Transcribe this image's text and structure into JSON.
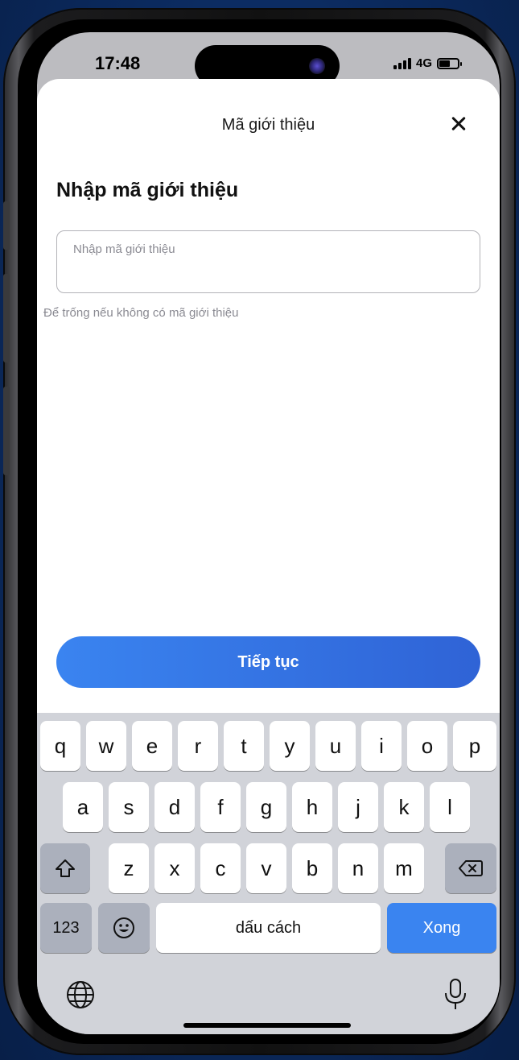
{
  "status_bar": {
    "time": "17:48",
    "network": "4G"
  },
  "sheet": {
    "title": "Mã giới thiệu",
    "heading": "Nhập mã giới thiệu",
    "input": {
      "placeholder": "Nhập mã giới thiệu",
      "value": ""
    },
    "hint": "Để trống nếu không có mã giới thiệu",
    "continue_label": "Tiếp tục"
  },
  "keyboard": {
    "row1": [
      "q",
      "w",
      "e",
      "r",
      "t",
      "y",
      "u",
      "i",
      "o",
      "p"
    ],
    "row2": [
      "a",
      "s",
      "d",
      "f",
      "g",
      "h",
      "j",
      "k",
      "l"
    ],
    "row3": [
      "z",
      "x",
      "c",
      "v",
      "b",
      "n",
      "m"
    ],
    "numbers_label": "123",
    "space_label": "dấu cách",
    "done_label": "Xong"
  },
  "colors": {
    "accent": "#3a84f0",
    "background": "#0b2a5e"
  }
}
